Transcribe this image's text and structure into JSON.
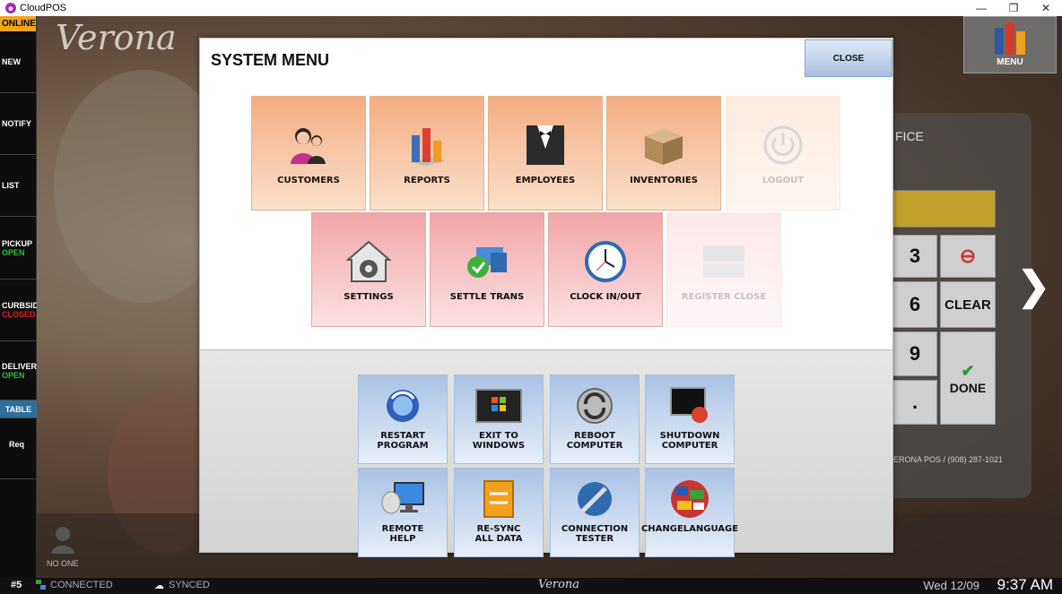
{
  "window": {
    "title": "CloudPOS",
    "min": "—",
    "restore": "❐",
    "close": "✕"
  },
  "sidebar": {
    "status": "ONLINE",
    "items": [
      {
        "label": "NEW",
        "state": ""
      },
      {
        "label": "NOTIFY",
        "state": ""
      },
      {
        "label": "LIST",
        "state": ""
      },
      {
        "label": "PICKUP",
        "state": "OPEN"
      },
      {
        "label": "CURBSID",
        "state": "CLOSED"
      },
      {
        "label": "DELIVER",
        "state": "OPEN"
      },
      {
        "label": "TABLE",
        "state": ""
      },
      {
        "label": "Req",
        "state": ""
      }
    ]
  },
  "background": {
    "brand": "Verona",
    "menu_label": "MENU",
    "panel_title": "FICE",
    "keys": [
      "3",
      "6",
      "9",
      ".",
      "CLEAR",
      "DONE"
    ],
    "footer": "ERONA POS / (908) 287-1021",
    "user": "NO ONE"
  },
  "modal": {
    "title": "SYSTEM MENU",
    "close_label": "CLOSE",
    "row1": [
      {
        "label": "CUSTOMERS",
        "icon": "customers-icon"
      },
      {
        "label": "REPORTS",
        "icon": "reports-icon"
      },
      {
        "label": "EMPLOYEES",
        "icon": "employees-icon"
      },
      {
        "label": "INVENTORIES",
        "icon": "inventories-icon"
      },
      {
        "label": "LOGOUT",
        "icon": "power-icon"
      }
    ],
    "row2": [
      {
        "label": "SETTINGS",
        "icon": "settings-icon"
      },
      {
        "label": "SETTLE TRANS",
        "icon": "settle-icon"
      },
      {
        "label": "CLOCK IN/OUT",
        "icon": "clock-icon"
      },
      {
        "label": "REGISTER CLOSE",
        "icon": "register-icon"
      }
    ],
    "system": [
      {
        "label": "RESTART\nPROGRAM",
        "icon": "restart-icon"
      },
      {
        "label": "EXIT TO\nWINDOWS",
        "icon": "windows-icon"
      },
      {
        "label": "REBOOT\nCOMPUTER",
        "icon": "reboot-icon"
      },
      {
        "label": "SHUTDOWN\nCOMPUTER",
        "icon": "shutdown-icon"
      },
      {
        "label": "REMOTE\nHELP",
        "icon": "remote-help-icon"
      },
      {
        "label": "RE-SYNC\nALL DATA",
        "icon": "resync-icon"
      },
      {
        "label": "CONNECTION\nTESTER",
        "icon": "connection-icon"
      },
      {
        "label": "CHANGELANGUAGE",
        "icon": "globe-icon"
      }
    ]
  },
  "statusbar": {
    "station": "#5",
    "connected": "CONNECTED",
    "synced": "SYNCED",
    "brand": "Verona",
    "date": "Wed 12/09",
    "time": "9:37 AM"
  }
}
